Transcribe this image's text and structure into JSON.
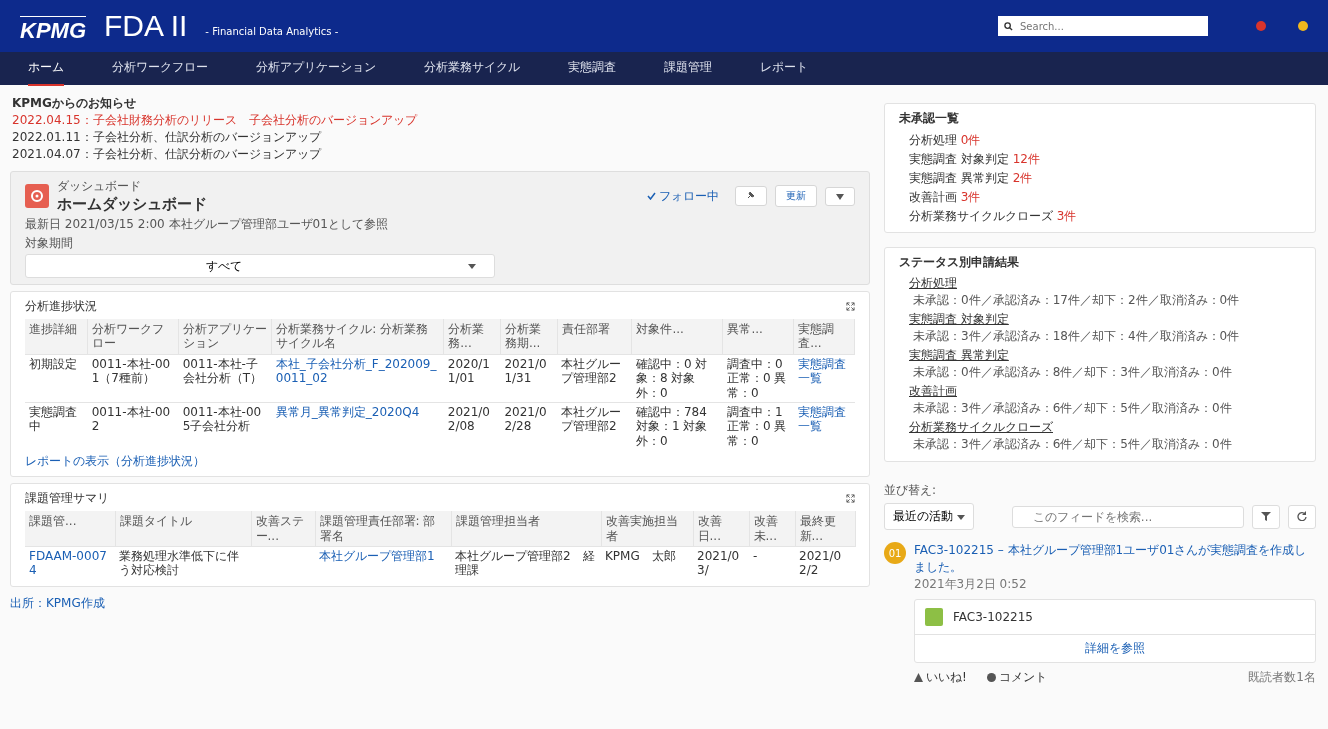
{
  "header": {
    "logo": "KPMG",
    "title": "FDA II",
    "subtitle": "- Financial Data Analytics -",
    "search": {
      "placeholder": "Search..."
    }
  },
  "nav": [
    {
      "label": "ホーム",
      "selected": true
    },
    {
      "label": "分析ワークフロー",
      "selected": false
    },
    {
      "label": "分析アプリケーション",
      "selected": false
    },
    {
      "label": "分析業務サイクル",
      "selected": false
    },
    {
      "label": "実態調査",
      "selected": false
    },
    {
      "label": "課題管理",
      "selected": false
    },
    {
      "label": "レポート",
      "selected": false
    }
  ],
  "notices": {
    "title": "KPMGからのお知らせ",
    "items": [
      {
        "text": "2022.04.15：子会社財務分析のリリース　子会社分析のバージョンアップ",
        "highlight": true
      },
      {
        "text": "2022.01.11：子会社分析、仕訳分析のバージョンアップ",
        "highlight": false
      },
      {
        "text": "2021.04.07：子会社分析、仕訳分析のバージョンアップ",
        "highlight": false
      }
    ]
  },
  "dashboard": {
    "kicker": "ダッシュボード",
    "title": "ホームダッシュボード",
    "info": "最新日 2021/03/15 2:00 本社グループ管理部ユーザ01として参照",
    "follow": "フォロー中",
    "refresh": "更新",
    "filter_label": "対象期間",
    "filter_value": "すべて"
  },
  "progress": {
    "title": "分析進捗状況",
    "columns": [
      "進捗詳細",
      "分析ワークフロー",
      "分析アプリケーション",
      "分析業務サイクル: 分析業務サイクル名",
      "分析業務...",
      "分析業務期...",
      "責任部署",
      "対象件...",
      "異常...",
      "実態調査..."
    ],
    "rows": [
      [
        "初期設定",
        "0011-本社-001（7種前）",
        "0011-本社-子会社分析（T）",
        "本社_子会社分析_F_202009_0011_02",
        "2020/11/01",
        "2021/01/31",
        "本社グループ管理部2",
        "確認中：0 対象：8 対象外：0",
        "調査中：0 正常：0 異常：0",
        "実態調査一覧"
      ],
      [
        "実態調査中",
        "0011-本社-002",
        "0011-本社-005子会社分析",
        "異常月_異常判定_2020Q4",
        "2021/02/08",
        "2021/02/28",
        "本社グループ管理部2",
        "確認中：784 対象：1 対象外：0",
        "調査中：1 正常：0 異常：0",
        "実態調査一覧"
      ]
    ],
    "report_link": "レポートの表示（分析進捗状況）"
  },
  "issues": {
    "title": "課題管理サマリ",
    "columns": [
      "課題管...",
      "課題タイトル",
      "改善ステー...",
      "課題管理責任部署: 部署名",
      "課題管理担当者",
      "改善実施担当者",
      "改善日...",
      "改善未...",
      "最終更新..."
    ],
    "rows": [
      [
        "FDAAM-00074",
        "業務処理水準低下に伴う対応検討",
        "",
        "本社グループ管理部1",
        "本社グループ管理部2　経理課",
        "KPMG　太郎",
        "2021/03/",
        "-",
        "2021/02/2"
      ]
    ]
  },
  "caption": "出所：KPMG作成",
  "pending": {
    "title": "未承認一覧",
    "items": [
      {
        "label": "分析処理",
        "count": "0件"
      },
      {
        "label": "実態調査 対象判定",
        "count": "12件"
      },
      {
        "label": "実態調査 異常判定",
        "count": "2件"
      },
      {
        "label": "改善計画",
        "count": "3件"
      },
      {
        "label": "分析業務サイクルクローズ",
        "count": "3件"
      }
    ]
  },
  "status": {
    "title": "ステータス別申請結果",
    "items": [
      {
        "label": "分析処理",
        "detail": "未承認：0件／承認済み：17件／却下：2件／取消済み：0件"
      },
      {
        "label": "実態調査 対象判定",
        "detail": "未承認：3件／承認済み：18件／却下：4件／取消済み：0件"
      },
      {
        "label": "実態調査 異常判定",
        "detail": "未承認：0件／承認済み：8件／却下：3件／取消済み：0件"
      },
      {
        "label": "改善計画",
        "detail": "未承認：3件／承認済み：6件／却下：5件／取消済み：0件"
      },
      {
        "label": "分析業務サイクルクローズ",
        "detail": "未承認：3件／承認済み：6件／却下：5件／取消済み：0件"
      }
    ]
  },
  "feed": {
    "sort_label": "並び替え:",
    "sort_value": "最近の活動",
    "search": {
      "placeholder": "このフィードを検索..."
    },
    "post": {
      "avatar": "01",
      "text": "FAC3-102215 – 本社グループ管理部1ユーザ01さんが実態調査を作成しました。",
      "date": "2021年3月2日 0:52",
      "record": "FAC3-102215",
      "details": "詳細を参照",
      "like": "いいね!",
      "comment": "コメント",
      "seen": "既読者数1名"
    }
  }
}
